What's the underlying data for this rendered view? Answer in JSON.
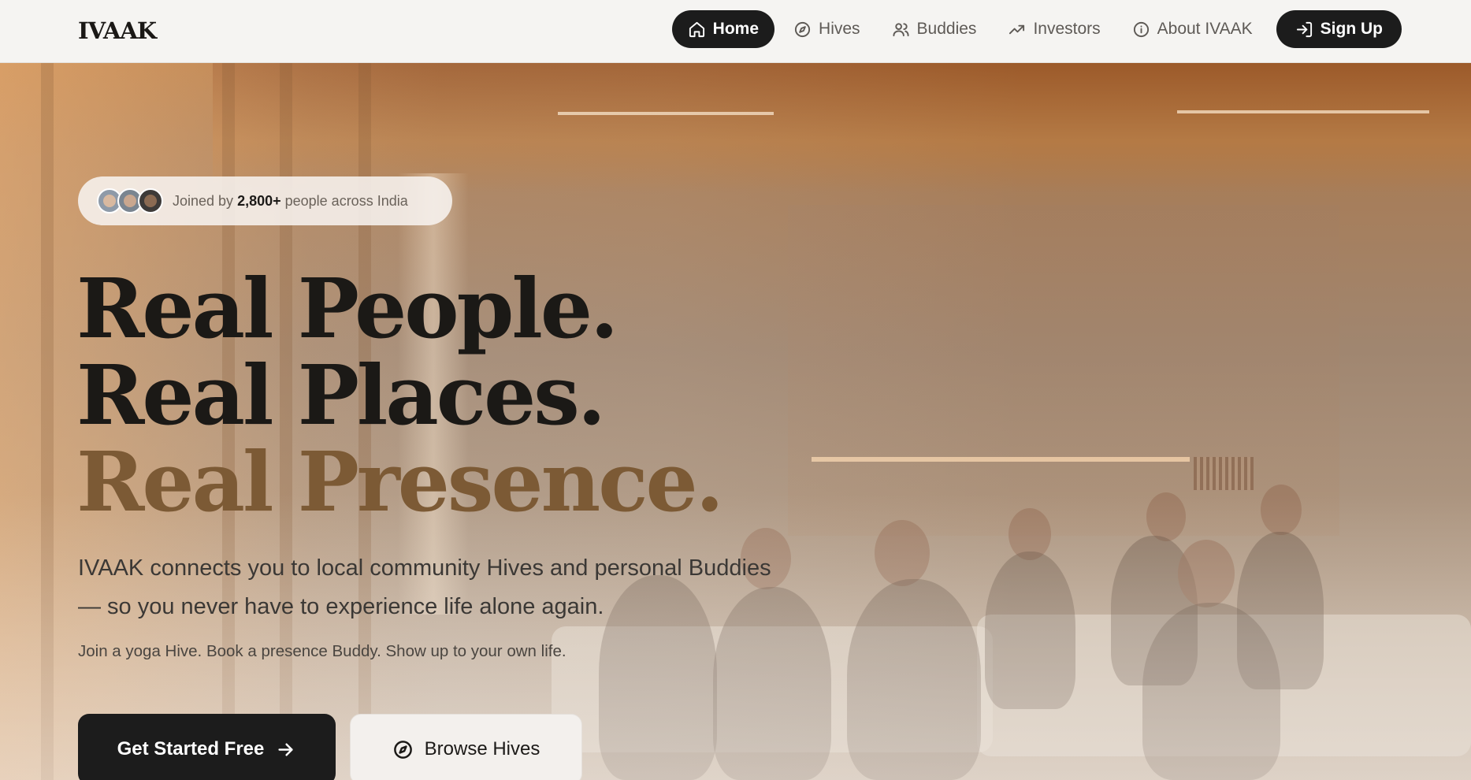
{
  "nav": {
    "logo": "IVAAK",
    "items": [
      {
        "label": "Home",
        "icon": "home-icon",
        "active": true
      },
      {
        "label": "Hives",
        "icon": "compass-icon"
      },
      {
        "label": "Buddies",
        "icon": "users-icon"
      },
      {
        "label": "Investors",
        "icon": "trending-up-icon"
      },
      {
        "label": "About IVAAK",
        "icon": "info-icon"
      }
    ],
    "signup_label": "Sign Up",
    "signup_icon": "log-in-icon"
  },
  "hero": {
    "badge": {
      "prefix": "Joined by",
      "count": "2,800+",
      "suffix": "people across India"
    },
    "headline": [
      "Real People.",
      "Real Places.",
      "Real Presence."
    ],
    "subheadline": "IVAAK connects you to local community Hives and personal Buddies — so you never have to experience life alone again.",
    "tagline": "Join a yoga Hive. Book a presence Buddy. Show up to your own life.",
    "cta_primary": "Get Started Free",
    "cta_secondary": "Browse Hives"
  },
  "colors": {
    "accent_dark": "#1c1c1c",
    "headline_accent": "#7c5a35",
    "background": "#f5f4f2"
  }
}
